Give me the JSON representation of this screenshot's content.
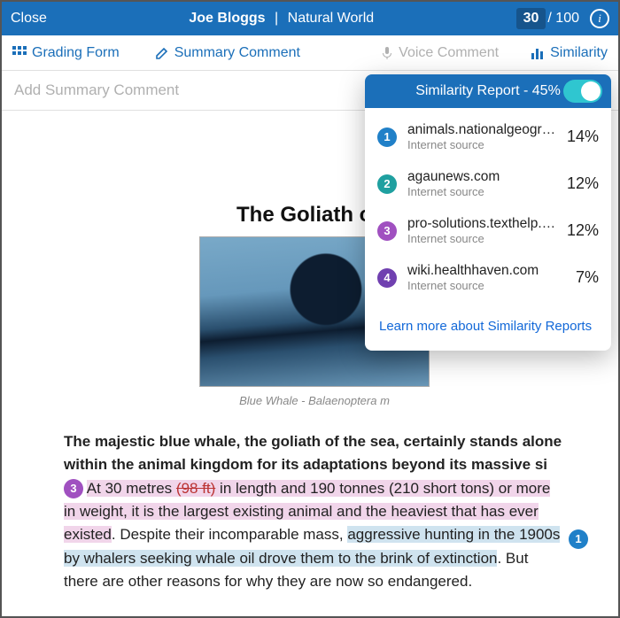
{
  "topbar": {
    "close": "Close",
    "student": "Joe Bloggs",
    "separator": "|",
    "assignment": "Natural World",
    "score": "30",
    "score_total": "/ 100"
  },
  "tabs": {
    "grading": "Grading Form",
    "summary": "Summary Comment",
    "voice": "Voice Comment",
    "similarity": "Similarity"
  },
  "summary_placeholder": "Add Summary Comment",
  "document": {
    "title_visible": "The Goliath of t",
    "caption_visible": "Blue Whale - Balaenoptera m",
    "body_lead": "The majestic blue whale, the goliath of the sea, certainly stands alone within the animal kingdom for its adaptations beyond its massive si",
    "seg_pink1": "At 30 metres ",
    "seg_strike": "(98 ft)",
    "seg_pink2": " in length and 190 tonnes (210 short tons) or more in weight, it is the largest existing animal and the heaviest that has ever existed",
    "plain_between": ". Despite their incomparable mass, ",
    "seg_blue": "aggressive hunting in the 1900s by whalers seeking whale oil drove them to the brink of extinction",
    "tail": ". But there are other reasons for why they are now so endangered.",
    "chip3": "3",
    "chip1": "1"
  },
  "panel": {
    "title": "Similarity Report - 45%",
    "sources": [
      {
        "n": "1",
        "color": "c1",
        "name": "animals.nationalgeogra…",
        "sub": "Internet source",
        "pct": "14%"
      },
      {
        "n": "2",
        "color": "c2",
        "name": "agaunews.com",
        "sub": "Internet source",
        "pct": "12%"
      },
      {
        "n": "3",
        "color": "c3",
        "name": "pro-solutions.texthelp.…",
        "sub": "Internet source",
        "pct": "12%"
      },
      {
        "n": "4",
        "color": "c4",
        "name": "wiki.healthhaven.com",
        "sub": "Internet source",
        "pct": "7%"
      }
    ],
    "learn_more": "Learn more about Similarity Reports"
  }
}
